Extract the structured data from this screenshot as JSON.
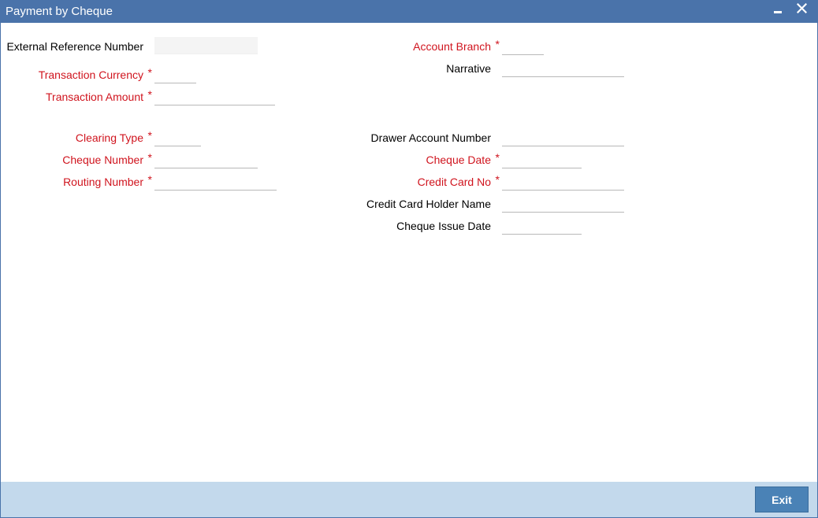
{
  "window": {
    "title": "Payment by Cheque",
    "minimize_icon": "minimize-icon",
    "close_icon": "close-icon"
  },
  "colors": {
    "titlebar": "#4a73aa",
    "required_label": "#d0141e",
    "footer": "#c3d9ec",
    "exit_button": "#4a82b6"
  },
  "form": {
    "left": {
      "external_reference_number": {
        "label": "External Reference Number",
        "value": "",
        "required": false,
        "read_only": true
      },
      "transaction_currency": {
        "label": "Transaction Currency",
        "value": "",
        "required": true
      },
      "transaction_amount": {
        "label": "Transaction Amount",
        "value": "",
        "required": true
      },
      "clearing_type": {
        "label": "Clearing Type",
        "value": "",
        "required": true
      },
      "cheque_number": {
        "label": "Cheque Number",
        "value": "",
        "required": true
      },
      "routing_number": {
        "label": "Routing Number",
        "value": "",
        "required": true
      }
    },
    "right": {
      "account_branch": {
        "label": "Account Branch",
        "value": "",
        "required": true
      },
      "narrative": {
        "label": "Narrative",
        "value": "",
        "required": false
      },
      "drawer_account_number": {
        "label": "Drawer Account Number",
        "value": "",
        "required": false
      },
      "cheque_date": {
        "label": "Cheque Date",
        "value": "",
        "required": true
      },
      "credit_card_no": {
        "label": "Credit Card No",
        "value": "",
        "required": true
      },
      "credit_card_holder_name": {
        "label": "Credit Card Holder Name",
        "value": "",
        "required": false
      },
      "cheque_issue_date": {
        "label": "Cheque Issue Date",
        "value": "",
        "required": false
      }
    },
    "required_marker": "*"
  },
  "footer": {
    "exit_label": "Exit"
  }
}
